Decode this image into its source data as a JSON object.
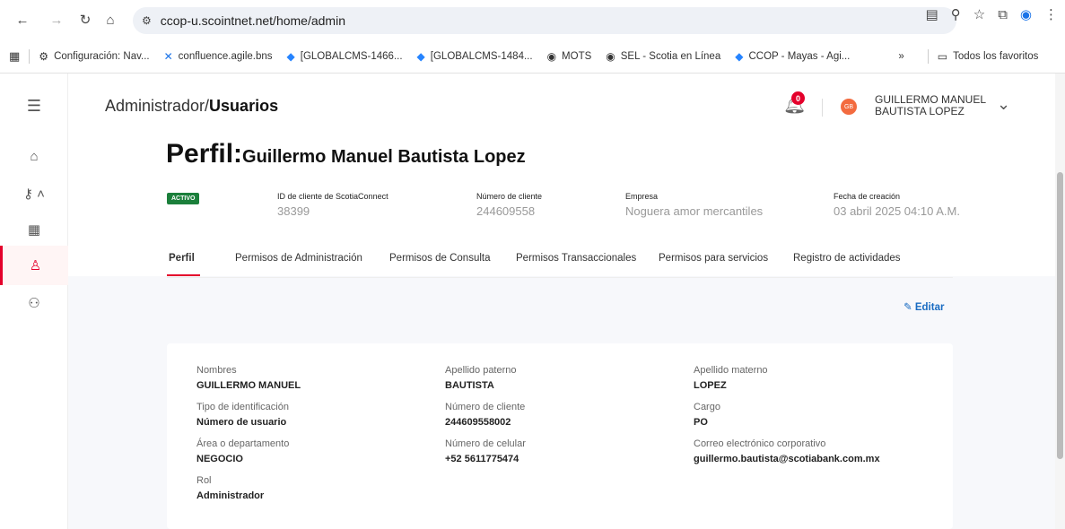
{
  "browser": {
    "url": "ccop-u.scointnet.net/home/admin",
    "bookmarks": [
      {
        "label": "Configuración: Nav...",
        "icon": "gear-icon"
      },
      {
        "label": "confluence.agile.bns",
        "icon": "confluence-icon"
      },
      {
        "label": "[GLOBALCMS-1466...",
        "icon": "jira-icon"
      },
      {
        "label": "[GLOBALCMS-1484...",
        "icon": "jira-icon"
      },
      {
        "label": "MOTS",
        "icon": "globe-icon"
      },
      {
        "label": "SEL - Scotia en Línea",
        "icon": "globe-icon"
      },
      {
        "label": "CCOP - Mayas - Agi...",
        "icon": "jira-icon"
      }
    ],
    "all_bookmarks": "Todos los favoritos"
  },
  "header": {
    "breadcrumb_prefix": "Administrador/",
    "breadcrumb_current": "Usuarios",
    "notification_count": "0",
    "avatar_initials": "GB",
    "user_name_line1": "GUILLERMO MANUEL",
    "user_name_line2": "BAUTISTA LOPEZ"
  },
  "profile": {
    "title_prefix": "Perfil:",
    "name": "Guillermo Manuel Bautista Lopez",
    "status": "ACTIVO",
    "meta": [
      {
        "label": "ID de cliente de ScotiaConnect",
        "value": "38399"
      },
      {
        "label": "Número de cliente",
        "value": "244609558"
      },
      {
        "label": "Empresa",
        "value": "Noguera amor mercantiles"
      },
      {
        "label": "Fecha de creación",
        "value": "03 abril 2025 04:10 A.M."
      }
    ]
  },
  "tabs": [
    {
      "label": "Perfil"
    },
    {
      "label": "Permisos de Administración"
    },
    {
      "label": "Permisos de Consulta"
    },
    {
      "label": "Permisos Transaccionales"
    },
    {
      "label": "Permisos para servicios"
    },
    {
      "label": "Registro de actividades"
    }
  ],
  "edit_label": "Editar",
  "fields": {
    "nombres": {
      "label": "Nombres",
      "value": "GUILLERMO MANUEL"
    },
    "apellido_paterno": {
      "label": "Apellido paterno",
      "value": "BAUTISTA"
    },
    "apellido_materno": {
      "label": "Apellido materno",
      "value": "LOPEZ"
    },
    "tipo_identificacion": {
      "label": "Tipo de identificación",
      "value": "Número de usuario"
    },
    "numero_cliente": {
      "label": "Número de cliente",
      "value": "244609558002"
    },
    "cargo": {
      "label": "Cargo",
      "value": "PO"
    },
    "area": {
      "label": "Área o departamento",
      "value": "NEGOCIO"
    },
    "celular": {
      "label": "Número de celular",
      "value": "+52 5611775474"
    },
    "correo": {
      "label": "Correo electrónico corporativo",
      "value": "guillermo.bautista@scotiabank.com.mx"
    },
    "rol": {
      "label": "Rol",
      "value": "Administrador"
    }
  }
}
